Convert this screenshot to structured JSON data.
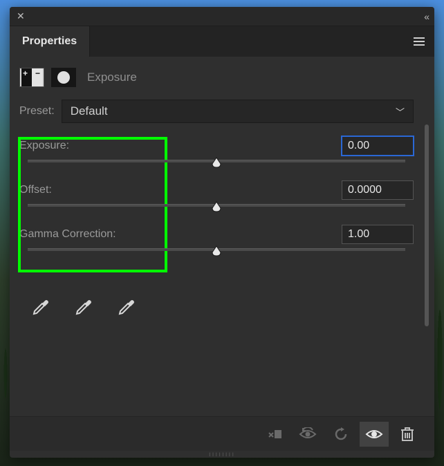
{
  "tab": {
    "title": "Properties"
  },
  "heading": {
    "title": "Exposure"
  },
  "preset": {
    "label": "Preset:",
    "value": "Default"
  },
  "sliders": {
    "exposure": {
      "label": "Exposure:",
      "value": "0.00",
      "pos": 0.5,
      "focused": true
    },
    "offset": {
      "label": "Offset:",
      "value": "0.0000",
      "pos": 0.5,
      "focused": false
    },
    "gamma": {
      "label": "Gamma Correction:",
      "value": "1.00",
      "pos": 0.5,
      "focused": false
    }
  },
  "icons": {
    "adjustment": "exposure-adjustment-icon",
    "mask": "layer-mask-icon",
    "dropper_black": "sample-black-point",
    "dropper_gray": "sample-gray-point",
    "dropper_white": "sample-white-point",
    "clip": "clip-to-layer",
    "prev": "view-previous-state",
    "reset": "reset-to-default",
    "visible": "toggle-visibility",
    "trash": "delete-adjustment"
  }
}
